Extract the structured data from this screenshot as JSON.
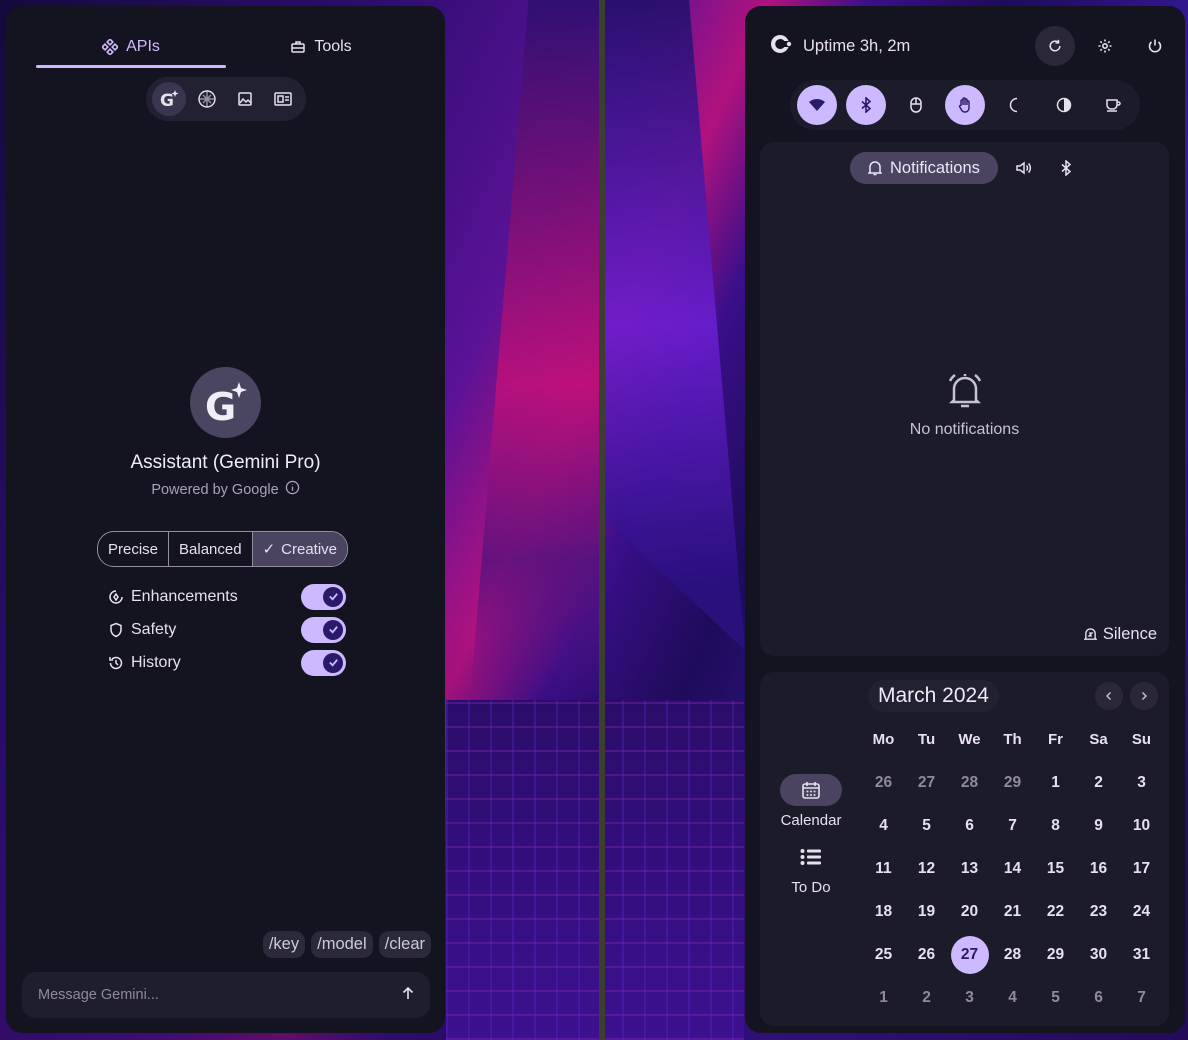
{
  "left": {
    "tabs": [
      {
        "label": "APIs"
      },
      {
        "label": "Tools"
      }
    ],
    "api_buttons": [
      "gemini",
      "openai",
      "image",
      "waifu"
    ],
    "assistant": {
      "title": "Assistant (Gemini Pro)",
      "subtitle": "Powered by Google"
    },
    "modes": [
      {
        "label": "Precise"
      },
      {
        "label": "Balanced"
      },
      {
        "label": "Creative",
        "check": "✓"
      }
    ],
    "options": [
      {
        "label": "Enhancements",
        "on": true
      },
      {
        "label": "Safety",
        "on": true
      },
      {
        "label": "History",
        "on": true
      }
    ],
    "commands": [
      "/key",
      "/model",
      "/clear"
    ],
    "input": {
      "placeholder": "Message Gemini...",
      "value": ""
    }
  },
  "right": {
    "uptime": "Uptime 3h, 2m",
    "notifications": {
      "tab_label": "Notifications",
      "empty_text": "No notifications",
      "silence_label": "Silence"
    },
    "calendar": {
      "month": "March 2024",
      "side": [
        {
          "label": "Calendar"
        },
        {
          "label": "To Do"
        }
      ],
      "dows": [
        "Mo",
        "Tu",
        "We",
        "Th",
        "Fr",
        "Sa",
        "Su"
      ],
      "days": [
        [
          "26",
          "27",
          "28",
          "29",
          "1",
          "2",
          "3"
        ],
        [
          "4",
          "5",
          "6",
          "7",
          "8",
          "9",
          "10"
        ],
        [
          "11",
          "12",
          "13",
          "14",
          "15",
          "16",
          "17"
        ],
        [
          "18",
          "19",
          "20",
          "21",
          "22",
          "23",
          "24"
        ],
        [
          "25",
          "26",
          "27",
          "28",
          "29",
          "30",
          "31"
        ],
        [
          "1",
          "2",
          "3",
          "4",
          "5",
          "6",
          "7"
        ]
      ],
      "today": "27"
    }
  },
  "colors": {
    "accent": "#cdb9ff",
    "panel": "#141320",
    "card": "#1c1b29"
  }
}
